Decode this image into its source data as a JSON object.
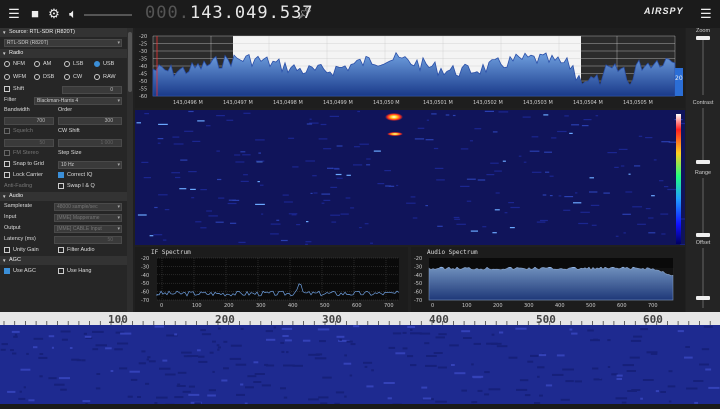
{
  "topbar": {
    "freq_dim": "000.",
    "freq_main": "143.049.537",
    "logo": "AIRSPY",
    "icons": [
      "menu-icon",
      "stop-icon",
      "gear-icon",
      "speaker-icon",
      "pin-icon",
      "hamburger-icon"
    ]
  },
  "sidebar": {
    "source": {
      "header": "Source: RTL-SDR (R820T)",
      "device": "RTL-SDR (R820T)"
    },
    "radio": {
      "header": "Radio",
      "modes_row1": [
        "NFM",
        "AM",
        "LSB",
        "USB"
      ],
      "modes_row2": [
        "WFM",
        "DSB",
        "CW",
        "RAW"
      ],
      "selected_mode": "USB",
      "shift_label": "Shift",
      "shift_value": "0",
      "filter_label": "Filter",
      "filter_value": "Blackman-Harris 4",
      "bandwidth_label": "Bandwidth",
      "order_label": "Order",
      "bandwidth_value": "700",
      "order_value": "300",
      "squelch_label": "Squelch",
      "cw_shift_label": "CW Shift",
      "squelch_value": "50",
      "cw_shift_value": "1 000",
      "fm_stereo_label": "FM Stereo",
      "step_size_label": "Step Size",
      "snap_label": "Snap to Grid",
      "step_value": "10 Hz",
      "lock_carrier_label": "Lock Carrier",
      "correct_iq_label": "Correct IQ",
      "anti_fading_label": "Anti-Fading",
      "swap_iq_label": "Swap I & Q"
    },
    "audio": {
      "header": "Audio",
      "samplerate_label": "Samplerate",
      "samplerate_value": "48000 sample/sec",
      "input_label": "Input",
      "input_value": "[MME] Mapperame",
      "output_label": "Output",
      "output_value": "[MME] CABLE Input",
      "latency_label": "Latency (ms)",
      "latency_value": "50",
      "unity_gain_label": "Unity Gain",
      "filter_audio_label": "Filter Audio"
    },
    "agc": {
      "header": "AGC",
      "use_agc_label": "Use AGC",
      "use_hang_label": "Use Hang"
    }
  },
  "spectrum": {
    "y_ticks": [
      "-20",
      "-25",
      "-30",
      "-35",
      "-40",
      "-45",
      "-50",
      "-55",
      "-60"
    ],
    "x_ticks": [
      "143,0496 M",
      "143,0497 M",
      "143,0498 M",
      "143,0499 M",
      "143,050 M",
      "143,0501 M",
      "143,0502 M",
      "143,0503 M",
      "143,0504 M",
      "143,0505 M"
    ]
  },
  "if_spectrum": {
    "title": "IF Spectrum",
    "y_ticks": [
      "-20",
      "-30",
      "-40",
      "-50",
      "-60",
      "-70"
    ],
    "x_ticks": [
      "0",
      "100",
      "200",
      "300",
      "400",
      "500",
      "600",
      "700"
    ]
  },
  "audio_spectrum": {
    "title": "Audio Spectrum",
    "y_ticks": [
      "-20",
      "-30",
      "-40",
      "-50",
      "-60",
      "-70"
    ],
    "x_ticks": [
      "0",
      "100",
      "200",
      "300",
      "400",
      "500",
      "600",
      "700"
    ]
  },
  "right_panel": {
    "zoom_label": "Zoom",
    "contrast_label": "Contrast",
    "range_label": "Range",
    "offset_label": "Offset",
    "value_20": "20"
  },
  "bottom_ruler": {
    "labels": [
      "100",
      "200",
      "300",
      "400",
      "500",
      "600"
    ]
  }
}
